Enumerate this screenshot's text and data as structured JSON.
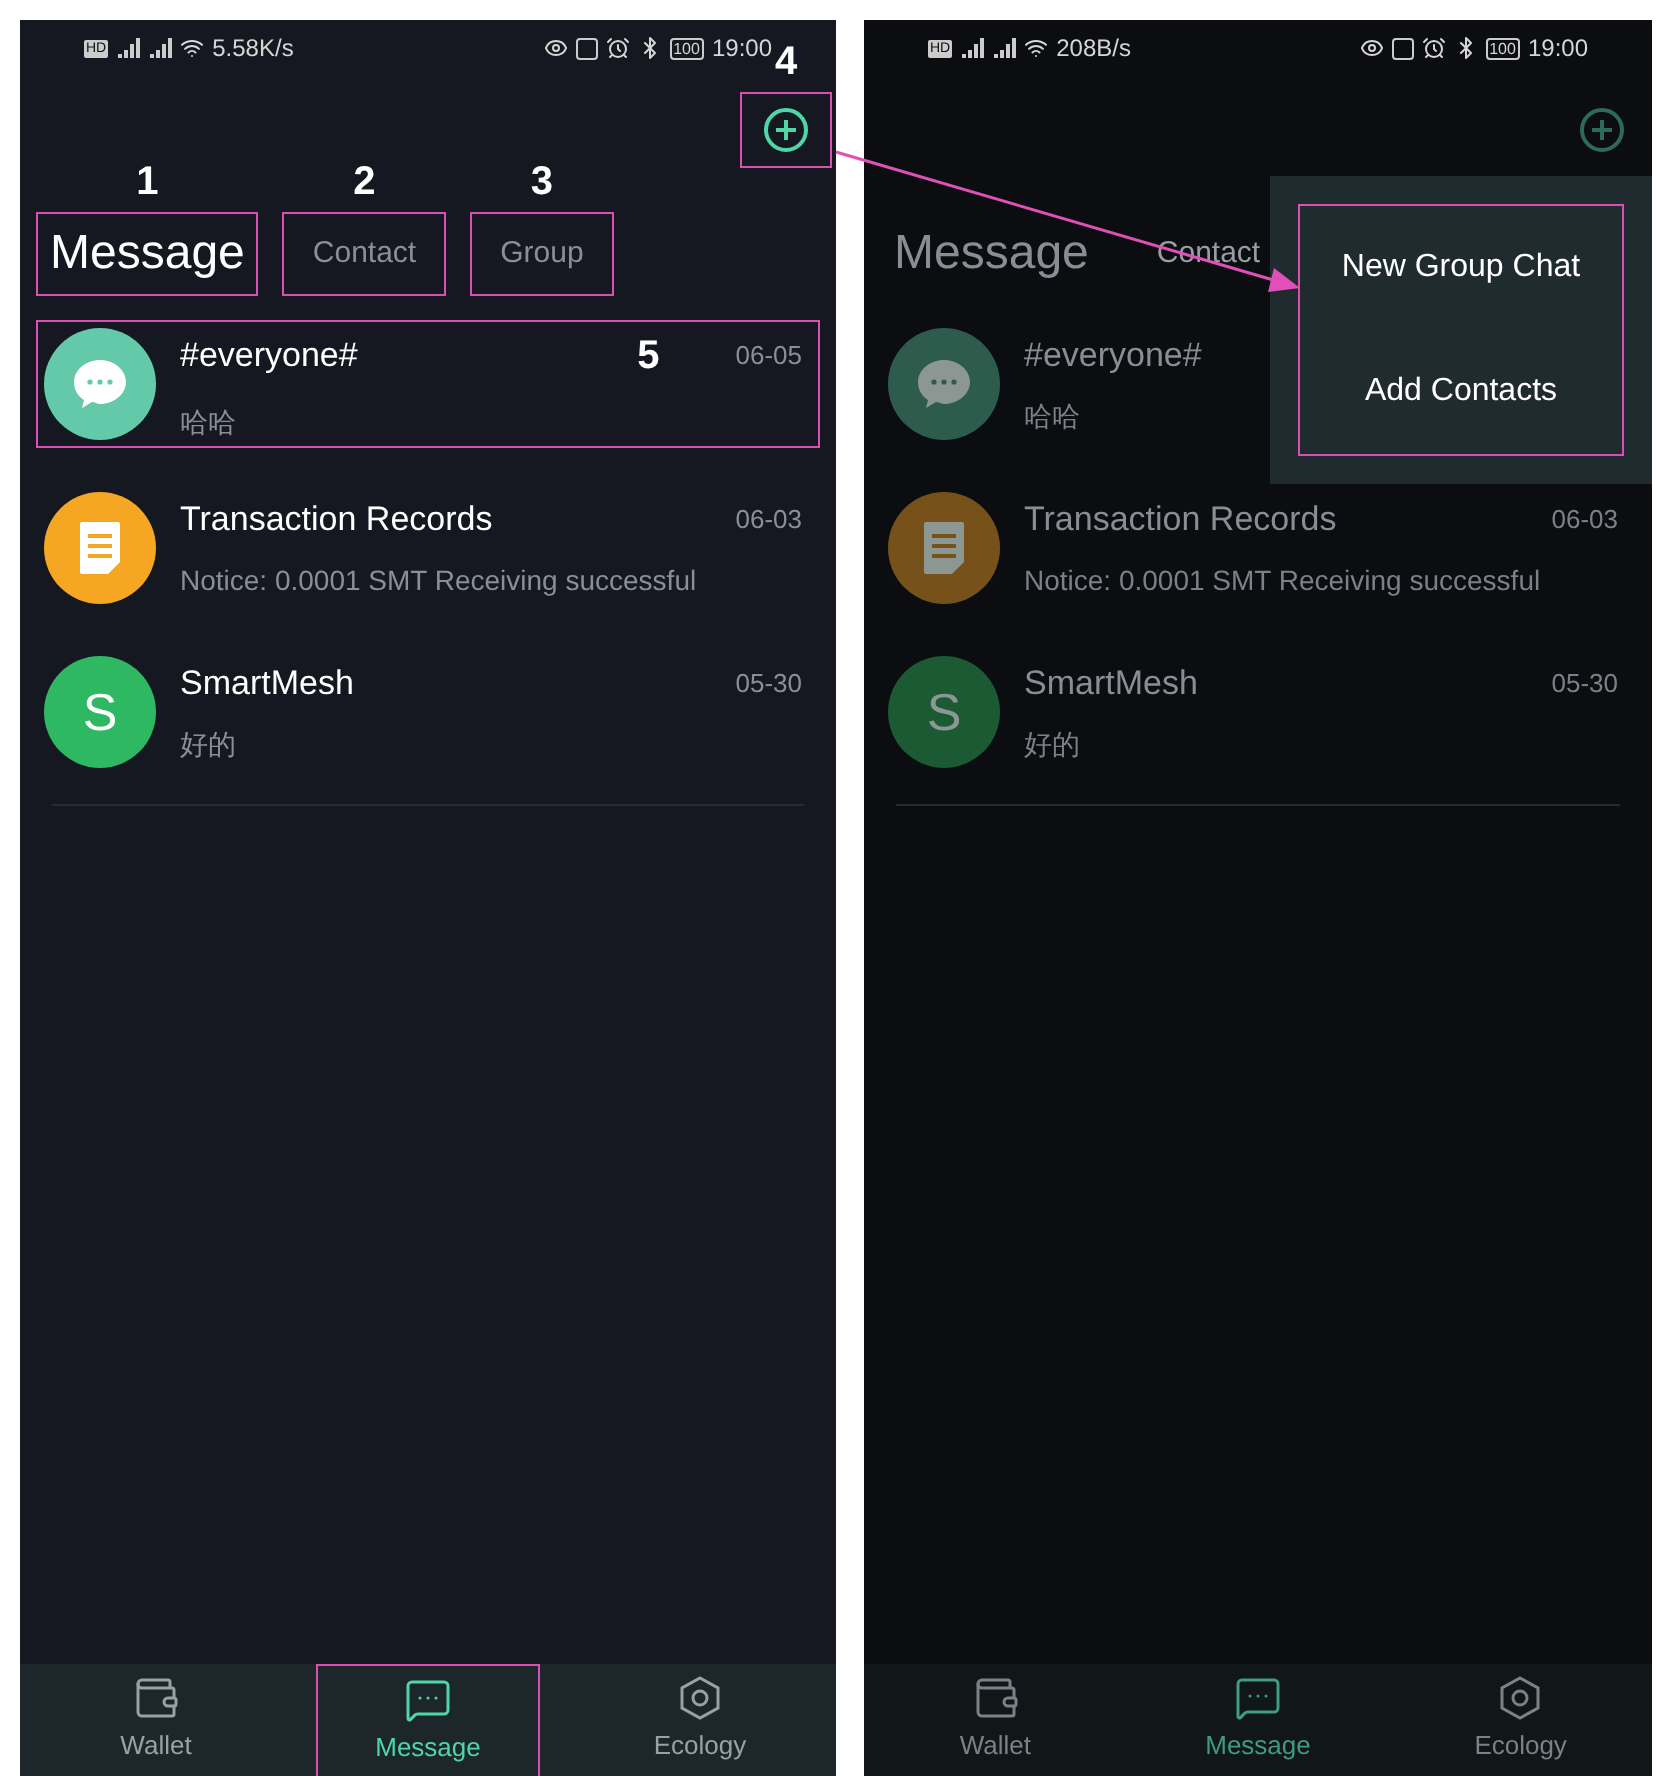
{
  "screens": [
    {
      "dimmed": false,
      "status_bar": {
        "hd_badge": "HD",
        "speed": "5.58K/s",
        "battery": "100",
        "time": "19:00"
      },
      "add_button": {
        "annotation": "4"
      },
      "tabs": [
        {
          "label": "Message",
          "selected": true,
          "annotation": "1"
        },
        {
          "label": "Contact",
          "selected": false,
          "annotation": "2"
        },
        {
          "label": "Group",
          "selected": false,
          "annotation": "3"
        }
      ],
      "conversations": [
        {
          "kind": "chat",
          "color": "#63c9a8",
          "name": "#everyone#",
          "date": "06-05",
          "preview": "哈哈",
          "annotation": "5"
        },
        {
          "kind": "document",
          "color": "#f5a623",
          "name": "Transaction Records",
          "date": "06-03",
          "preview": "Notice: 0.0001 SMT Receiving successful"
        },
        {
          "kind": "letter",
          "letter": "S",
          "color": "#2fb862",
          "name": "SmartMesh",
          "date": "05-30",
          "preview": "好的"
        }
      ],
      "nav": [
        {
          "kind": "wallet",
          "label": "Wallet",
          "selected": false,
          "annotated": false
        },
        {
          "kind": "message",
          "label": "Message",
          "selected": true,
          "annotated": true
        },
        {
          "kind": "ecology",
          "label": "Ecology",
          "selected": false,
          "annotated": false
        }
      ]
    },
    {
      "dimmed": true,
      "status_bar": {
        "hd_badge": "HD",
        "speed": "208B/s",
        "battery": "100",
        "time": "19:00"
      },
      "tabs": [
        {
          "label": "Message",
          "selected": true
        },
        {
          "label": "Contact",
          "selected": false
        }
      ],
      "conversations": [
        {
          "kind": "chat",
          "color": "#2d5c4d",
          "name": "#everyone#",
          "preview": "哈哈"
        },
        {
          "kind": "document",
          "color": "#76521a",
          "name": "Transaction Records",
          "date": "06-03",
          "preview": "Notice: 0.0001 SMT Receiving successful"
        },
        {
          "kind": "letter",
          "letter": "S",
          "color": "#1b5a33",
          "name": "SmartMesh",
          "date": "05-30",
          "preview": "好的"
        }
      ],
      "nav": [
        {
          "kind": "wallet",
          "label": "Wallet",
          "selected": false,
          "annotated": false
        },
        {
          "kind": "message",
          "label": "Message",
          "selected": true,
          "annotated": false
        },
        {
          "kind": "ecology",
          "label": "Ecology",
          "selected": false,
          "annotated": false
        }
      ],
      "menu": {
        "annotated": true,
        "items": [
          "New Group Chat",
          "Add Contacts"
        ]
      }
    }
  ]
}
